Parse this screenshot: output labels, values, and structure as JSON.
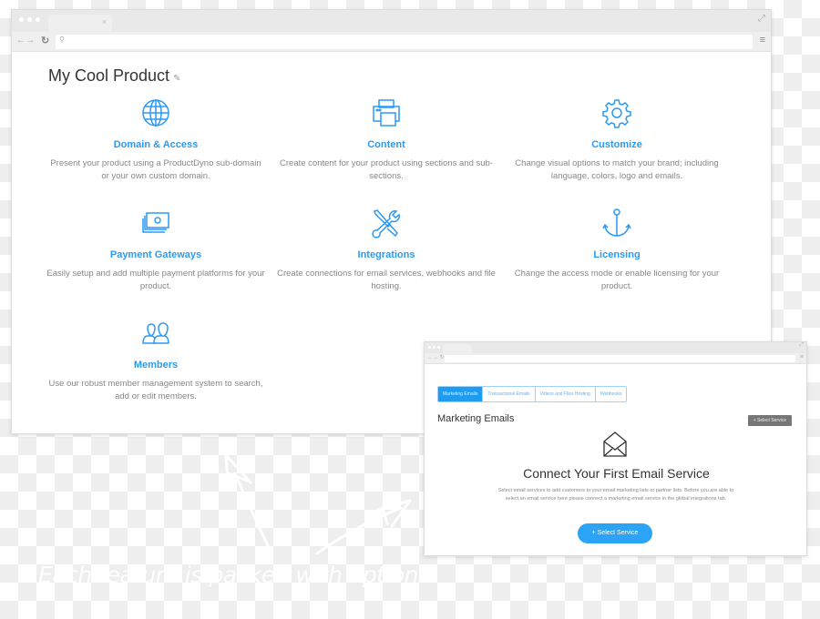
{
  "main_window": {
    "title": "My Cool Product",
    "features": [
      {
        "icon": "globe-icon",
        "title": "Domain & Access",
        "desc": "Present your product using a ProductDyno sub-domain or your own custom domain."
      },
      {
        "icon": "printer-icon",
        "title": "Content",
        "desc": "Create content for your product using sections and sub-sections."
      },
      {
        "icon": "gear-icon",
        "title": "Customize",
        "desc": "Change visual options to match your brand; including language, colors, logo and emails."
      },
      {
        "icon": "money-icon",
        "title": "Payment Gateways",
        "desc": "Easily setup and add multiple payment platforms for your product."
      },
      {
        "icon": "tools-icon",
        "title": "Integrations",
        "desc": "Create connections for email services, webhooks and file hosting."
      },
      {
        "icon": "anchor-icon",
        "title": "Licensing",
        "desc": "Change the access mode or enable licensing for your product."
      },
      {
        "icon": "users-icon",
        "title": "Members",
        "desc": "Use our robust member management system to search, add or edit members."
      }
    ]
  },
  "email_window": {
    "tabs": [
      "Marketing Emails",
      "Transactional Emails",
      "Videos and Files Hosting",
      "Webhooks"
    ],
    "active_tab": "Marketing Emails",
    "heading": "Marketing Emails",
    "select_small": "+ Select Service",
    "connect_title": "Connect Your First Email Service",
    "connect_desc": "Select email services to add customers to your email marketing lists or partner lists. Before you are able to select an email service here please connect a marketing email service in the global integrations tab.",
    "select_button": "+  Select Service"
  },
  "caption": "Each feature is packed with options!",
  "colors": {
    "accent": "#2b9af3",
    "tab_active": "#1f9cf0",
    "button": "#2ba4f5"
  }
}
